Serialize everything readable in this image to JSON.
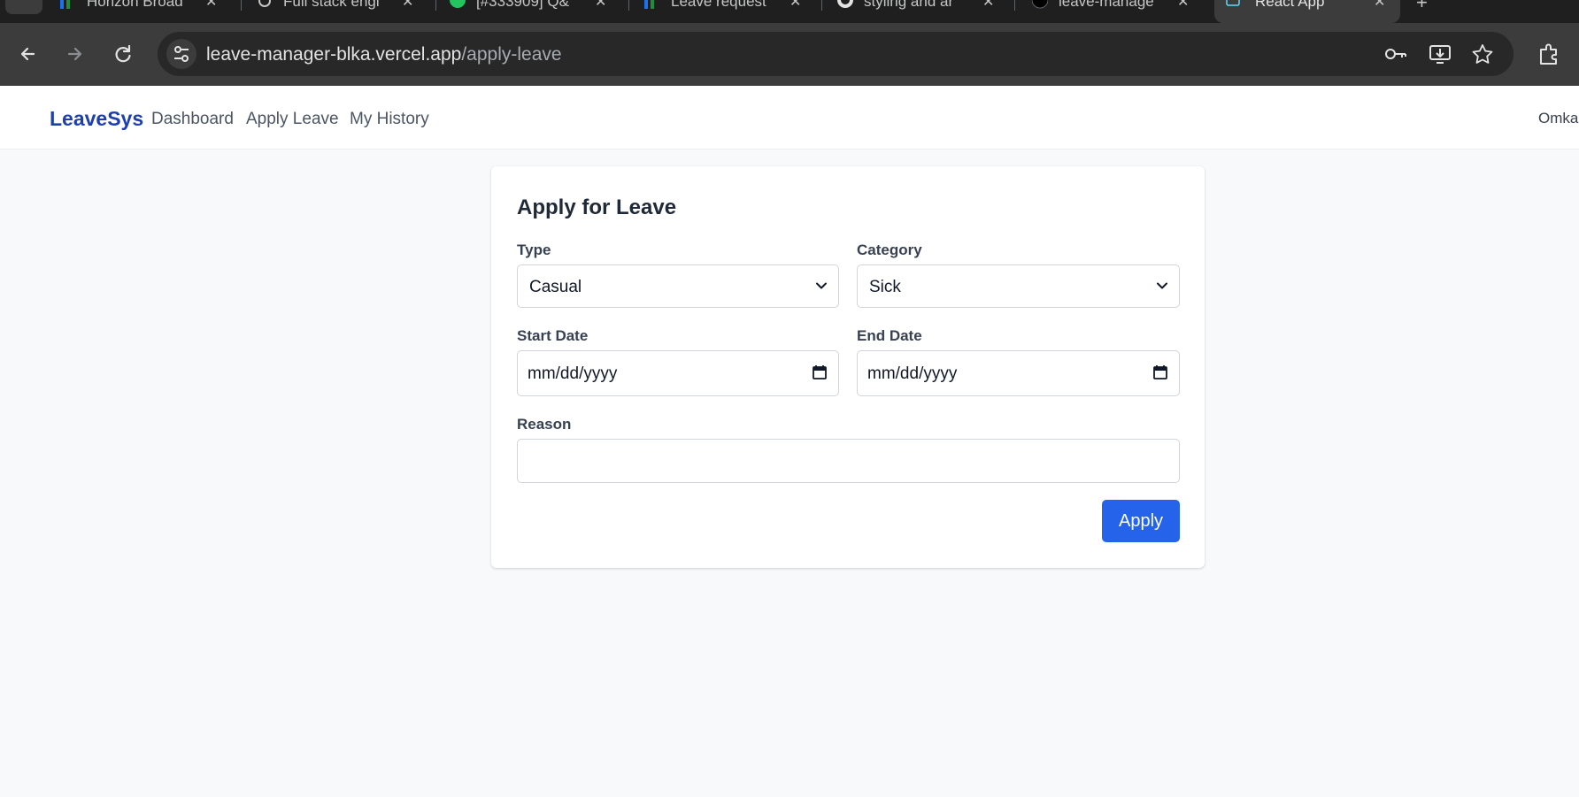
{
  "browser": {
    "tabs": [
      {
        "title": "Horizon Broad"
      },
      {
        "title": "Full stack engi"
      },
      {
        "title": "[#333909] Q&"
      },
      {
        "title": "Leave request"
      },
      {
        "title": "styling and ar"
      },
      {
        "title": "leave-manage"
      },
      {
        "title": "React App"
      }
    ],
    "url_host": "leave-manager-blka.vercel.app",
    "url_path": "/apply-leave"
  },
  "nav": {
    "brand": "LeaveSys",
    "links": [
      "Dashboard",
      "Apply Leave",
      "My History"
    ],
    "user": "Omka"
  },
  "form": {
    "title": "Apply for Leave",
    "type_label": "Type",
    "type_value": "Casual",
    "category_label": "Category",
    "category_value": "Sick",
    "start_label": "Start Date",
    "start_placeholder": "mm/dd/yyyy",
    "end_label": "End Date",
    "end_placeholder": "mm/dd/yyyy",
    "reason_label": "Reason",
    "reason_value": "",
    "submit": "Apply"
  },
  "colors": {
    "brand": "#1e40af",
    "primary_button": "#2563eb",
    "page_background": "#f8f9fb"
  }
}
